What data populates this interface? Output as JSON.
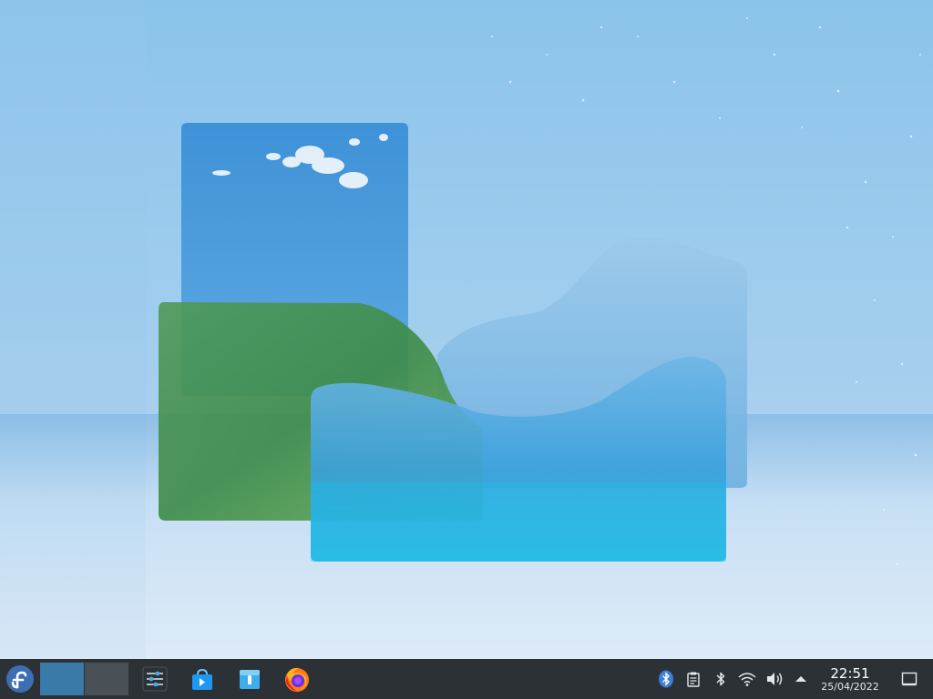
{
  "desktop": {
    "wallpaper": "glass-landscape-wallpaper"
  },
  "taskbar": {
    "launcher_icon": "fedora-logo-icon",
    "pager": {
      "desktops": 2,
      "active": 1
    },
    "pinned_apps": [
      {
        "name": "system-settings",
        "icon": "settings-sliders-icon"
      },
      {
        "name": "discover",
        "icon": "software-store-icon"
      },
      {
        "name": "dolphin",
        "icon": "file-manager-icon"
      },
      {
        "name": "firefox",
        "icon": "firefox-icon"
      }
    ],
    "tray": [
      {
        "name": "bluetooth-status",
        "icon": "bluetooth-circle-icon"
      },
      {
        "name": "clipboard",
        "icon": "clipboard-icon"
      },
      {
        "name": "bluetooth",
        "icon": "bluetooth-icon"
      },
      {
        "name": "network",
        "icon": "wifi-icon"
      },
      {
        "name": "volume",
        "icon": "speaker-icon"
      },
      {
        "name": "expand-tray",
        "icon": "chevron-up-icon"
      }
    ],
    "clock": {
      "time": "22:51",
      "date": "25/04/2022"
    },
    "show_desktop_icon": "show-desktop-icon"
  },
  "colors": {
    "panel": "#2c3135",
    "pager_active": "#3a7aa8",
    "pager_inactive": "#4a5156"
  }
}
